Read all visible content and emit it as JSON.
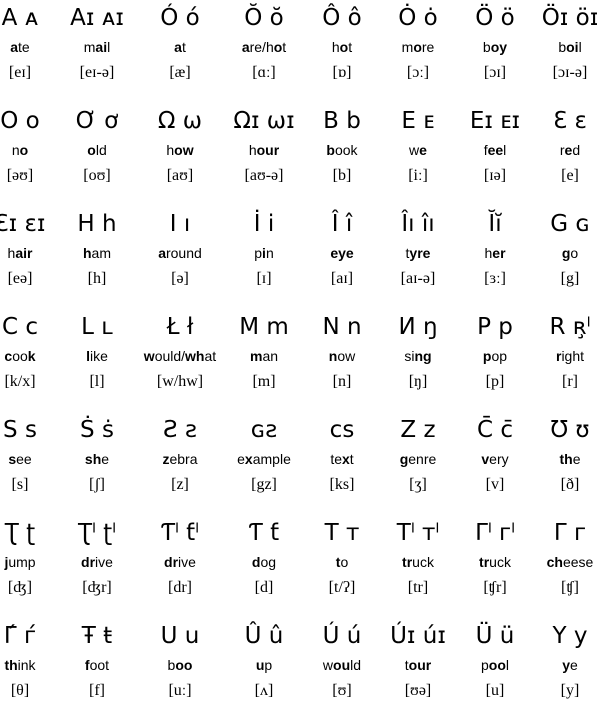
{
  "rows": [
    [
      {
        "letter": "A ᴀ",
        "word": [
          [
            "a",
            1
          ],
          [
            "te",
            0
          ]
        ],
        "ipa": "[eɪ]"
      },
      {
        "letter": "Aɪ ᴀɪ",
        "word": [
          [
            "m",
            0
          ],
          [
            "ai",
            1
          ],
          [
            "l",
            0
          ]
        ],
        "ipa": "[eɪ-ə]"
      },
      {
        "letter": "Ó ó",
        "word": [
          [
            "a",
            1
          ],
          [
            "t",
            0
          ]
        ],
        "ipa": "[æ]"
      },
      {
        "letter": "Ŏ ŏ",
        "word": [
          [
            "a",
            1
          ],
          [
            "re/h",
            0
          ],
          [
            "o",
            1
          ],
          [
            "t",
            0
          ]
        ],
        "ipa": "[ɑː]"
      },
      {
        "letter": "Ô ô",
        "word": [
          [
            "h",
            0
          ],
          [
            "o",
            1
          ],
          [
            "t",
            0
          ]
        ],
        "ipa": "[ɒ]"
      },
      {
        "letter": "Ȯ ȯ",
        "word": [
          [
            "m",
            0
          ],
          [
            "o",
            1
          ],
          [
            "re",
            0
          ]
        ],
        "ipa": "[ɔː]"
      },
      {
        "letter": "Ö ö",
        "word": [
          [
            "b",
            0
          ],
          [
            "oy",
            1
          ]
        ],
        "ipa": "[ɔɪ]"
      },
      {
        "letter": "Öɪ öɪ",
        "word": [
          [
            "b",
            0
          ],
          [
            "oi",
            1
          ],
          [
            "l",
            0
          ]
        ],
        "ipa": "[ɔɪ-ə]"
      }
    ],
    [
      {
        "letter": "O o",
        "word": [
          [
            "n",
            0
          ],
          [
            "o",
            1
          ]
        ],
        "ipa": "[əʊ]"
      },
      {
        "letter": "Ơ ơ",
        "word": [
          [
            "o",
            1
          ],
          [
            "ld",
            0
          ]
        ],
        "ipa": "[oʊ]"
      },
      {
        "letter": "Ω ω",
        "word": [
          [
            "h",
            0
          ],
          [
            "ow",
            1
          ]
        ],
        "ipa": "[aʊ]"
      },
      {
        "letter": "Ωɪ ωɪ",
        "word": [
          [
            "h",
            0
          ],
          [
            "our",
            1
          ]
        ],
        "ipa": "[aʊ-ə]"
      },
      {
        "letter": "B b",
        "word": [
          [
            "b",
            1
          ],
          [
            "ook",
            0
          ]
        ],
        "ipa": "[b]"
      },
      {
        "letter": "E ᴇ",
        "word": [
          [
            "w",
            0
          ],
          [
            "e",
            1
          ]
        ],
        "ipa": "[iː]"
      },
      {
        "letter": "Eɪ ᴇɪ",
        "word": [
          [
            "f",
            0
          ],
          [
            "ee",
            1
          ],
          [
            "l",
            0
          ]
        ],
        "ipa": "[ɪə]"
      },
      {
        "letter": "Ɛ ɛ",
        "word": [
          [
            "r",
            0
          ],
          [
            "e",
            1
          ],
          [
            "d",
            0
          ]
        ],
        "ipa": "[e]"
      }
    ],
    [
      {
        "letter": "Ɛɪ ɛɪ",
        "word": [
          [
            "h",
            0
          ],
          [
            "air",
            1
          ]
        ],
        "ipa": "[eə]"
      },
      {
        "letter": "H h",
        "word": [
          [
            "h",
            1
          ],
          [
            "am",
            0
          ]
        ],
        "ipa": "[h]"
      },
      {
        "letter": "I ı",
        "word": [
          [
            "a",
            1
          ],
          [
            "round",
            0
          ]
        ],
        "ipa": "[ə]"
      },
      {
        "letter": "İ i",
        "word": [
          [
            "p",
            0
          ],
          [
            "i",
            1
          ],
          [
            "n",
            0
          ]
        ],
        "ipa": "[ɪ]"
      },
      {
        "letter": "Î î",
        "word": [
          [
            "eye",
            1
          ]
        ],
        "ipa": "[aɪ]"
      },
      {
        "letter": "Îı îı",
        "word": [
          [
            "t",
            0
          ],
          [
            "yre",
            1
          ]
        ],
        "ipa": "[aɪ-ə]"
      },
      {
        "letter": "Ĭĭ",
        "word": [
          [
            "h",
            0
          ],
          [
            "er",
            1
          ]
        ],
        "ipa": "[ɜː]"
      },
      {
        "letter": "G ɢ",
        "word": [
          [
            "g",
            1
          ],
          [
            "o",
            0
          ]
        ],
        "ipa": "[g]"
      }
    ],
    [
      {
        "letter": "C c",
        "word": [
          [
            "c",
            1
          ],
          [
            "oo",
            0
          ],
          [
            "k",
            1
          ]
        ],
        "ipa": "[k/x]"
      },
      {
        "letter": "L ʟ",
        "word": [
          [
            "l",
            1
          ],
          [
            "ike",
            0
          ]
        ],
        "ipa": "[l]"
      },
      {
        "letter": "Ł ł",
        "word": [
          [
            "w",
            1
          ],
          [
            "ould/",
            0
          ],
          [
            "wh",
            1
          ],
          [
            "at",
            0
          ]
        ],
        "ipa": "[w/hw]"
      },
      {
        "letter": "M m",
        "word": [
          [
            "m",
            1
          ],
          [
            "an",
            0
          ]
        ],
        "ipa": "[m]"
      },
      {
        "letter": "N n",
        "word": [
          [
            "n",
            1
          ],
          [
            "ow",
            0
          ]
        ],
        "ipa": "[n]"
      },
      {
        "letter": "И ŋ",
        "word": [
          [
            "si",
            0
          ],
          [
            "ng",
            1
          ]
        ],
        "ipa": "[ŋ]"
      },
      {
        "letter": "P p",
        "word": [
          [
            "p",
            1
          ],
          [
            "op",
            0
          ]
        ],
        "ipa": "[p]"
      },
      {
        "letter": "R ʀ̧ˡ",
        "word": [
          [
            "r",
            1
          ],
          [
            "ight",
            0
          ]
        ],
        "ipa": "[r]"
      }
    ],
    [
      {
        "letter": "S ꜱ",
        "word": [
          [
            "s",
            1
          ],
          [
            "ee",
            0
          ]
        ],
        "ipa": "[s]"
      },
      {
        "letter": "Ṡ ṡ",
        "word": [
          [
            "sh",
            1
          ],
          [
            "e",
            0
          ]
        ],
        "ipa": "[ʃ]"
      },
      {
        "letter": "Ƨ ƨ",
        "word": [
          [
            "z",
            1
          ],
          [
            "ebra",
            0
          ]
        ],
        "ipa": "[z]"
      },
      {
        "letter": "ɢƨ",
        "word": [
          [
            "e",
            0
          ],
          [
            "x",
            1
          ],
          [
            "ample",
            0
          ]
        ],
        "ipa": "[gz]"
      },
      {
        "letter": "ᴄꜱ",
        "word": [
          [
            "te",
            0
          ],
          [
            "x",
            1
          ],
          [
            "t",
            0
          ]
        ],
        "ipa": "[ks]"
      },
      {
        "letter": "Z z",
        "word": [
          [
            "g",
            1
          ],
          [
            "enre",
            0
          ]
        ],
        "ipa": "[ʒ]"
      },
      {
        "letter": "C̄ c̄",
        "word": [
          [
            "v",
            1
          ],
          [
            "ery",
            0
          ]
        ],
        "ipa": "[v]"
      },
      {
        "letter": "Ʊ ʊ",
        "word": [
          [
            "th",
            1
          ],
          [
            "e",
            0
          ]
        ],
        "ipa": "[ð]"
      }
    ],
    [
      {
        "letter": "Ʈ ʈ",
        "word": [
          [
            "j",
            1
          ],
          [
            "ump",
            0
          ]
        ],
        "ipa": "[ʤ]"
      },
      {
        "letter": "Ʈˡ ʈˡ",
        "word": [
          [
            "dr",
            1
          ],
          [
            "ive",
            0
          ]
        ],
        "ipa": "[ʤr]"
      },
      {
        "letter": "Ƭˡ ƭˡ",
        "word": [
          [
            "dr",
            1
          ],
          [
            "ive",
            0
          ]
        ],
        "ipa": "[dr]"
      },
      {
        "letter": "Ƭ ƭ",
        "word": [
          [
            "d",
            1
          ],
          [
            "og",
            0
          ]
        ],
        "ipa": "[d]"
      },
      {
        "letter": "T ᴛ",
        "word": [
          [
            "t",
            1
          ],
          [
            "o",
            0
          ]
        ],
        "ipa": "[t/ʔ]"
      },
      {
        "letter": "Tˡ ᴛˡ",
        "word": [
          [
            "tr",
            1
          ],
          [
            "uck",
            0
          ]
        ],
        "ipa": "[tr]"
      },
      {
        "letter": "Γˡ гˡ",
        "word": [
          [
            "tr",
            1
          ],
          [
            "uck",
            0
          ]
        ],
        "ipa": "[ʧr]"
      },
      {
        "letter": "Γ г",
        "word": [
          [
            "ch",
            1
          ],
          [
            "eese",
            0
          ]
        ],
        "ipa": "[ʧ]"
      }
    ],
    [
      {
        "letter": "Γ́ ѓ",
        "word": [
          [
            "th",
            1
          ],
          [
            "ink",
            0
          ]
        ],
        "ipa": "[θ]"
      },
      {
        "letter": "Ŧ ŧ",
        "word": [
          [
            "f",
            1
          ],
          [
            "oot",
            0
          ]
        ],
        "ipa": "[f]"
      },
      {
        "letter": "U u",
        "word": [
          [
            "b",
            0
          ],
          [
            "oo",
            1
          ]
        ],
        "ipa": "[uː]"
      },
      {
        "letter": "Û û",
        "word": [
          [
            "u",
            1
          ],
          [
            "p",
            0
          ]
        ],
        "ipa": "[ʌ]"
      },
      {
        "letter": "Ú ú",
        "word": [
          [
            "w",
            0
          ],
          [
            "ou",
            1
          ],
          [
            "ld",
            0
          ]
        ],
        "ipa": "[ʊ]"
      },
      {
        "letter": "Úɪ úɪ",
        "word": [
          [
            "t",
            0
          ],
          [
            "our",
            1
          ]
        ],
        "ipa": "[ʊə]"
      },
      {
        "letter": "Ü ü",
        "word": [
          [
            "p",
            0
          ],
          [
            "oo",
            1
          ],
          [
            "l",
            0
          ]
        ],
        "ipa": "[u]"
      },
      {
        "letter": "Y y",
        "word": [
          [
            "y",
            1
          ],
          [
            "e",
            0
          ]
        ],
        "ipa": "[y]"
      }
    ]
  ]
}
